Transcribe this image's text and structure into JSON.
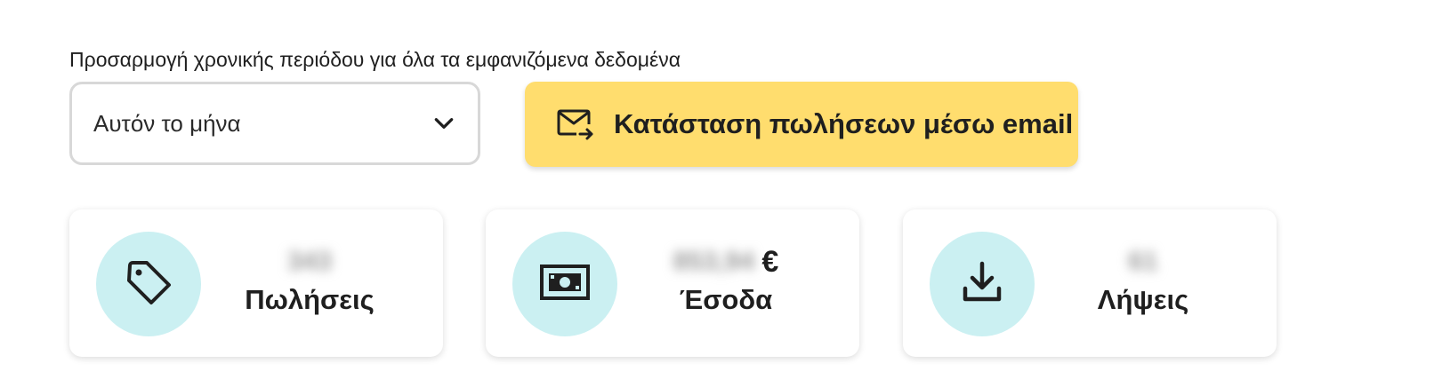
{
  "filter": {
    "label": "Προσαρμογή χρονικής περιόδου για όλα τα εμφανιζόμενα δεδομένα",
    "selected": "Αυτόν το μήνα",
    "icon": "chevron-down-icon"
  },
  "email_button": {
    "label": "Κατάσταση πωλήσεων μέσω email",
    "icon": "mail-forward-icon",
    "color": "#ffdd6e"
  },
  "accent_circle_color": "#cbf0f2",
  "cards": {
    "sales": {
      "icon": "tag-icon",
      "value": "343",
      "title": "Πωλήσεις"
    },
    "revenue": {
      "icon": "banknote-icon",
      "value": "853,94",
      "currency": "€",
      "title": "Έσοδα"
    },
    "downloads": {
      "icon": "download-icon",
      "value": "61",
      "title": "Λήψεις"
    }
  }
}
